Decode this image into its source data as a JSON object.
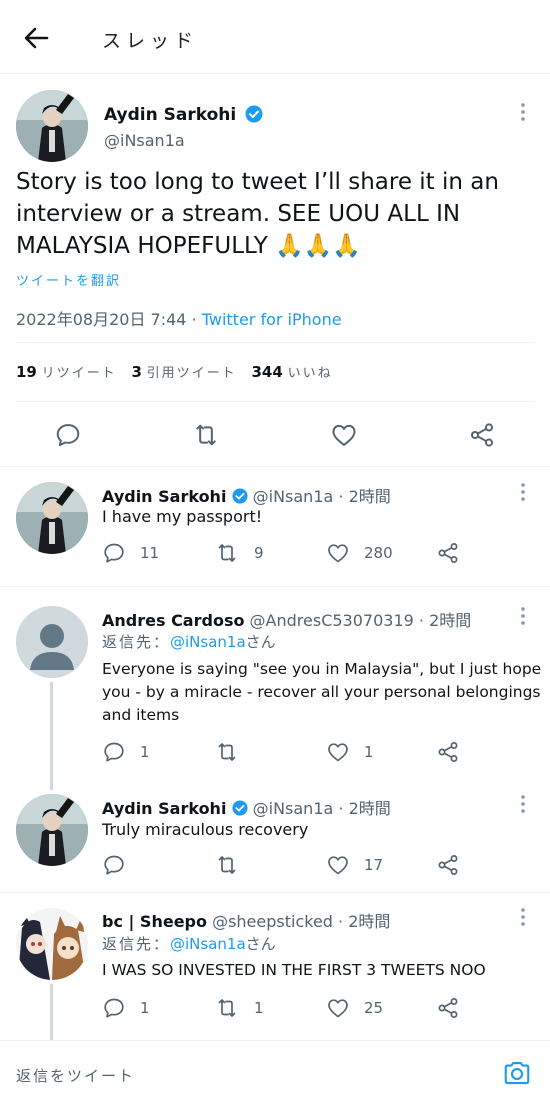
{
  "header": {
    "title": "スレッド"
  },
  "main_tweet": {
    "name": "Aydin Sarkohi",
    "handle": "@iNsan1a",
    "text": "Story is too long to tweet I’ll share it in an interview or a stream. SEE UOU ALL IN MALAYSIA HOPEFULLY 🙏🙏🙏",
    "text_lines": [
      "Story is too long to tweet I’ll share it in an",
      "interview or a stream. SEE UOU ALL IN",
      "MALAYSIA HOPEFULLY 🙏🙏🙏"
    ],
    "translate": "ツイートを翻訳",
    "datetime": "2022年08月20日 7:44",
    "dot": "·",
    "source": "Twitter for iPhone",
    "retweets": "19",
    "retweets_label": "リツイート",
    "quotes": "3",
    "quotes_label": "引用ツイート",
    "likes": "344",
    "likes_label": "いいね"
  },
  "replies": [
    {
      "name": "Aydin Sarkohi",
      "handle": "@iNsan1a",
      "time": "· 2時間",
      "text": "I have my passport!",
      "replies": "11",
      "retweets": "9",
      "likes": "280"
    },
    {
      "name": "Andres Cardoso",
      "handle": "@AndresC53070319",
      "time": "· 2時間",
      "reply_to_prefix": "返信先：",
      "reply_to_handle": "@iNsan1a",
      "reply_to_suffix": "さん",
      "text_lines": [
        "Everyone is saying \"see you in Malaysia\", but I just hope",
        "you - by a miracle - recover all your personal belongings",
        "and items"
      ],
      "replies": "1",
      "retweets": "",
      "likes": "1"
    },
    {
      "name": "Aydin Sarkohi",
      "handle": "@iNsan1a",
      "time": "· 2時間",
      "text": "Truly miraculous recovery",
      "replies": "",
      "retweets": "",
      "likes": "17"
    },
    {
      "name": "bc | Sheepo",
      "handle": "@sheepsticked",
      "time": "· 2時間",
      "reply_to_prefix": "返信先：",
      "reply_to_handle": "@iNsan1a",
      "reply_to_suffix": "さん",
      "text": "I WAS SO INVESTED IN THE FIRST 3 TWEETS NOO",
      "replies": "1",
      "retweets": "1",
      "likes": "25"
    }
  ],
  "compose": {
    "placeholder": "返信をツイート"
  },
  "colors": {
    "accent": "#1d9bf0",
    "secondary_text": "#536471",
    "border": "#eff3f4"
  },
  "icons": [
    "back-arrow-icon",
    "verified-badge-icon",
    "more-icon",
    "reply-icon",
    "retweet-icon",
    "like-icon",
    "share-icon",
    "camera-icon"
  ]
}
